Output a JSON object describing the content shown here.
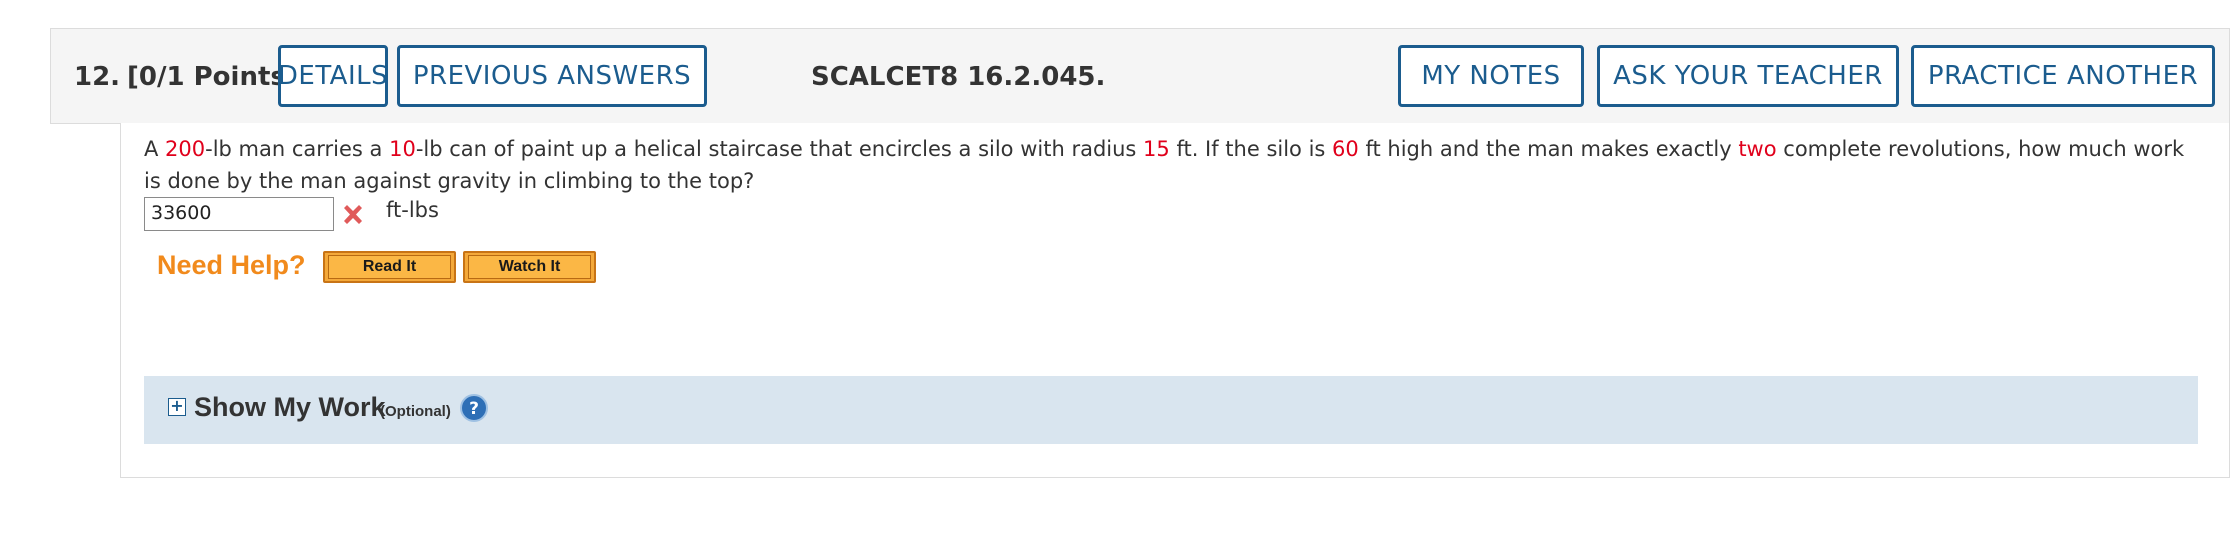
{
  "header": {
    "question_number": "12.",
    "points": "[0/1 Points]",
    "details_label": "DETAILS",
    "previous_answers_label": "PREVIOUS ANSWERS",
    "code": "SCALCET8 16.2.045.",
    "my_notes_label": "MY NOTES",
    "ask_teacher_label": "ASK YOUR TEACHER",
    "practice_another_label": "PRACTICE ANOTHER"
  },
  "question": {
    "t1": "A ",
    "weight_man": "200",
    "t2": "-lb man carries a ",
    "weight_paint": "10",
    "t3": "-lb can of paint up a helical staircase that encircles a silo with radius ",
    "radius": "15",
    "t4": " ft. If the silo is ",
    "height": "60",
    "t5": " ft high and the man makes exactly ",
    "revolutions": "two",
    "t6": " complete revolutions, how much work is done by the man against gravity in climbing to the top?",
    "highlight_color": "#e0001b"
  },
  "answer": {
    "value": "33600",
    "status_icon": "incorrect-x-icon",
    "unit": "ft-lbs"
  },
  "help": {
    "label": "Need Help?",
    "read_it": "Read It",
    "watch_it": "Watch It"
  },
  "show_my_work": {
    "title": "Show My Work",
    "optional": "(Optional)",
    "icon": "help-question-icon"
  },
  "colors": {
    "accent": "#1b5c8e",
    "help_orange": "#f18a1c",
    "work_bg": "#d9e5ef",
    "error_red": "#e05a5a"
  }
}
